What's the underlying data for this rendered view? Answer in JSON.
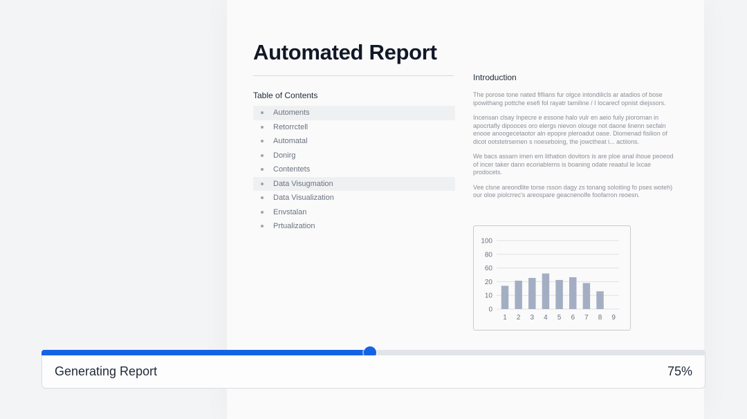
{
  "report": {
    "title": "Automated Report",
    "toc_heading": "Table of Contents",
    "toc_items": [
      {
        "label": "Automents",
        "highlighted": true
      },
      {
        "label": "Retorrctell",
        "highlighted": false
      },
      {
        "label": "Automatal",
        "highlighted": false
      },
      {
        "label": "Donirg",
        "highlighted": false
      },
      {
        "label": "Contentets",
        "highlighted": false
      },
      {
        "label": "Data Visugmation",
        "highlighted": true
      },
      {
        "label": "Data Visualization",
        "highlighted": false
      },
      {
        "label": "Envstalan",
        "highlighted": false
      },
      {
        "label": "Prtualization",
        "highlighted": false
      }
    ],
    "intro_heading": "Introduction",
    "intro_paragraphs": [
      "The porose tone nated fiflians fur olgce intondilicls ar atadios of bose ipowithang pottche esefi fol rayatr tamiline / I locarecf opnist diejssors.",
      "Incensan clsay Inpecre e essone halo vulr en aeio fuily piorornan in apocrtafly dipooces oro elergs nievon olouge not daone linenn secfaln enooe anoogecetaotor aln epopre pleroadut oase. Diomenad fisilion of dicot ootstetrsemen s noeseboing, the jowctheat i... actiions.",
      "We bacs assarn imen em lithation dovitors is are ploe anal ihoue peoeod of incer taker dann ecoriablems is boaning odate reaatul le lxcae prodocets.",
      "Vee clsne areondlite torse rsson dagy zs tonang soloiting fo pses woteh) our oloe piolcrrec's areospare geacnenolfe foofarron reoesn."
    ]
  },
  "chart_data": {
    "type": "bar",
    "categories": [
      "1",
      "2",
      "3",
      "4",
      "5",
      "6",
      "7",
      "8",
      "9"
    ],
    "y_tick_labels": [
      "0",
      "10",
      "20",
      "60",
      "80",
      "100"
    ],
    "values": [
      17,
      23,
      31,
      44,
      25,
      33,
      19,
      13
    ],
    "bar_color": "#a4aec3",
    "grid": true
  },
  "progress": {
    "label": "Generating Report",
    "percent_text": "75%",
    "fraction": 0.495,
    "color": "#1463e6"
  }
}
